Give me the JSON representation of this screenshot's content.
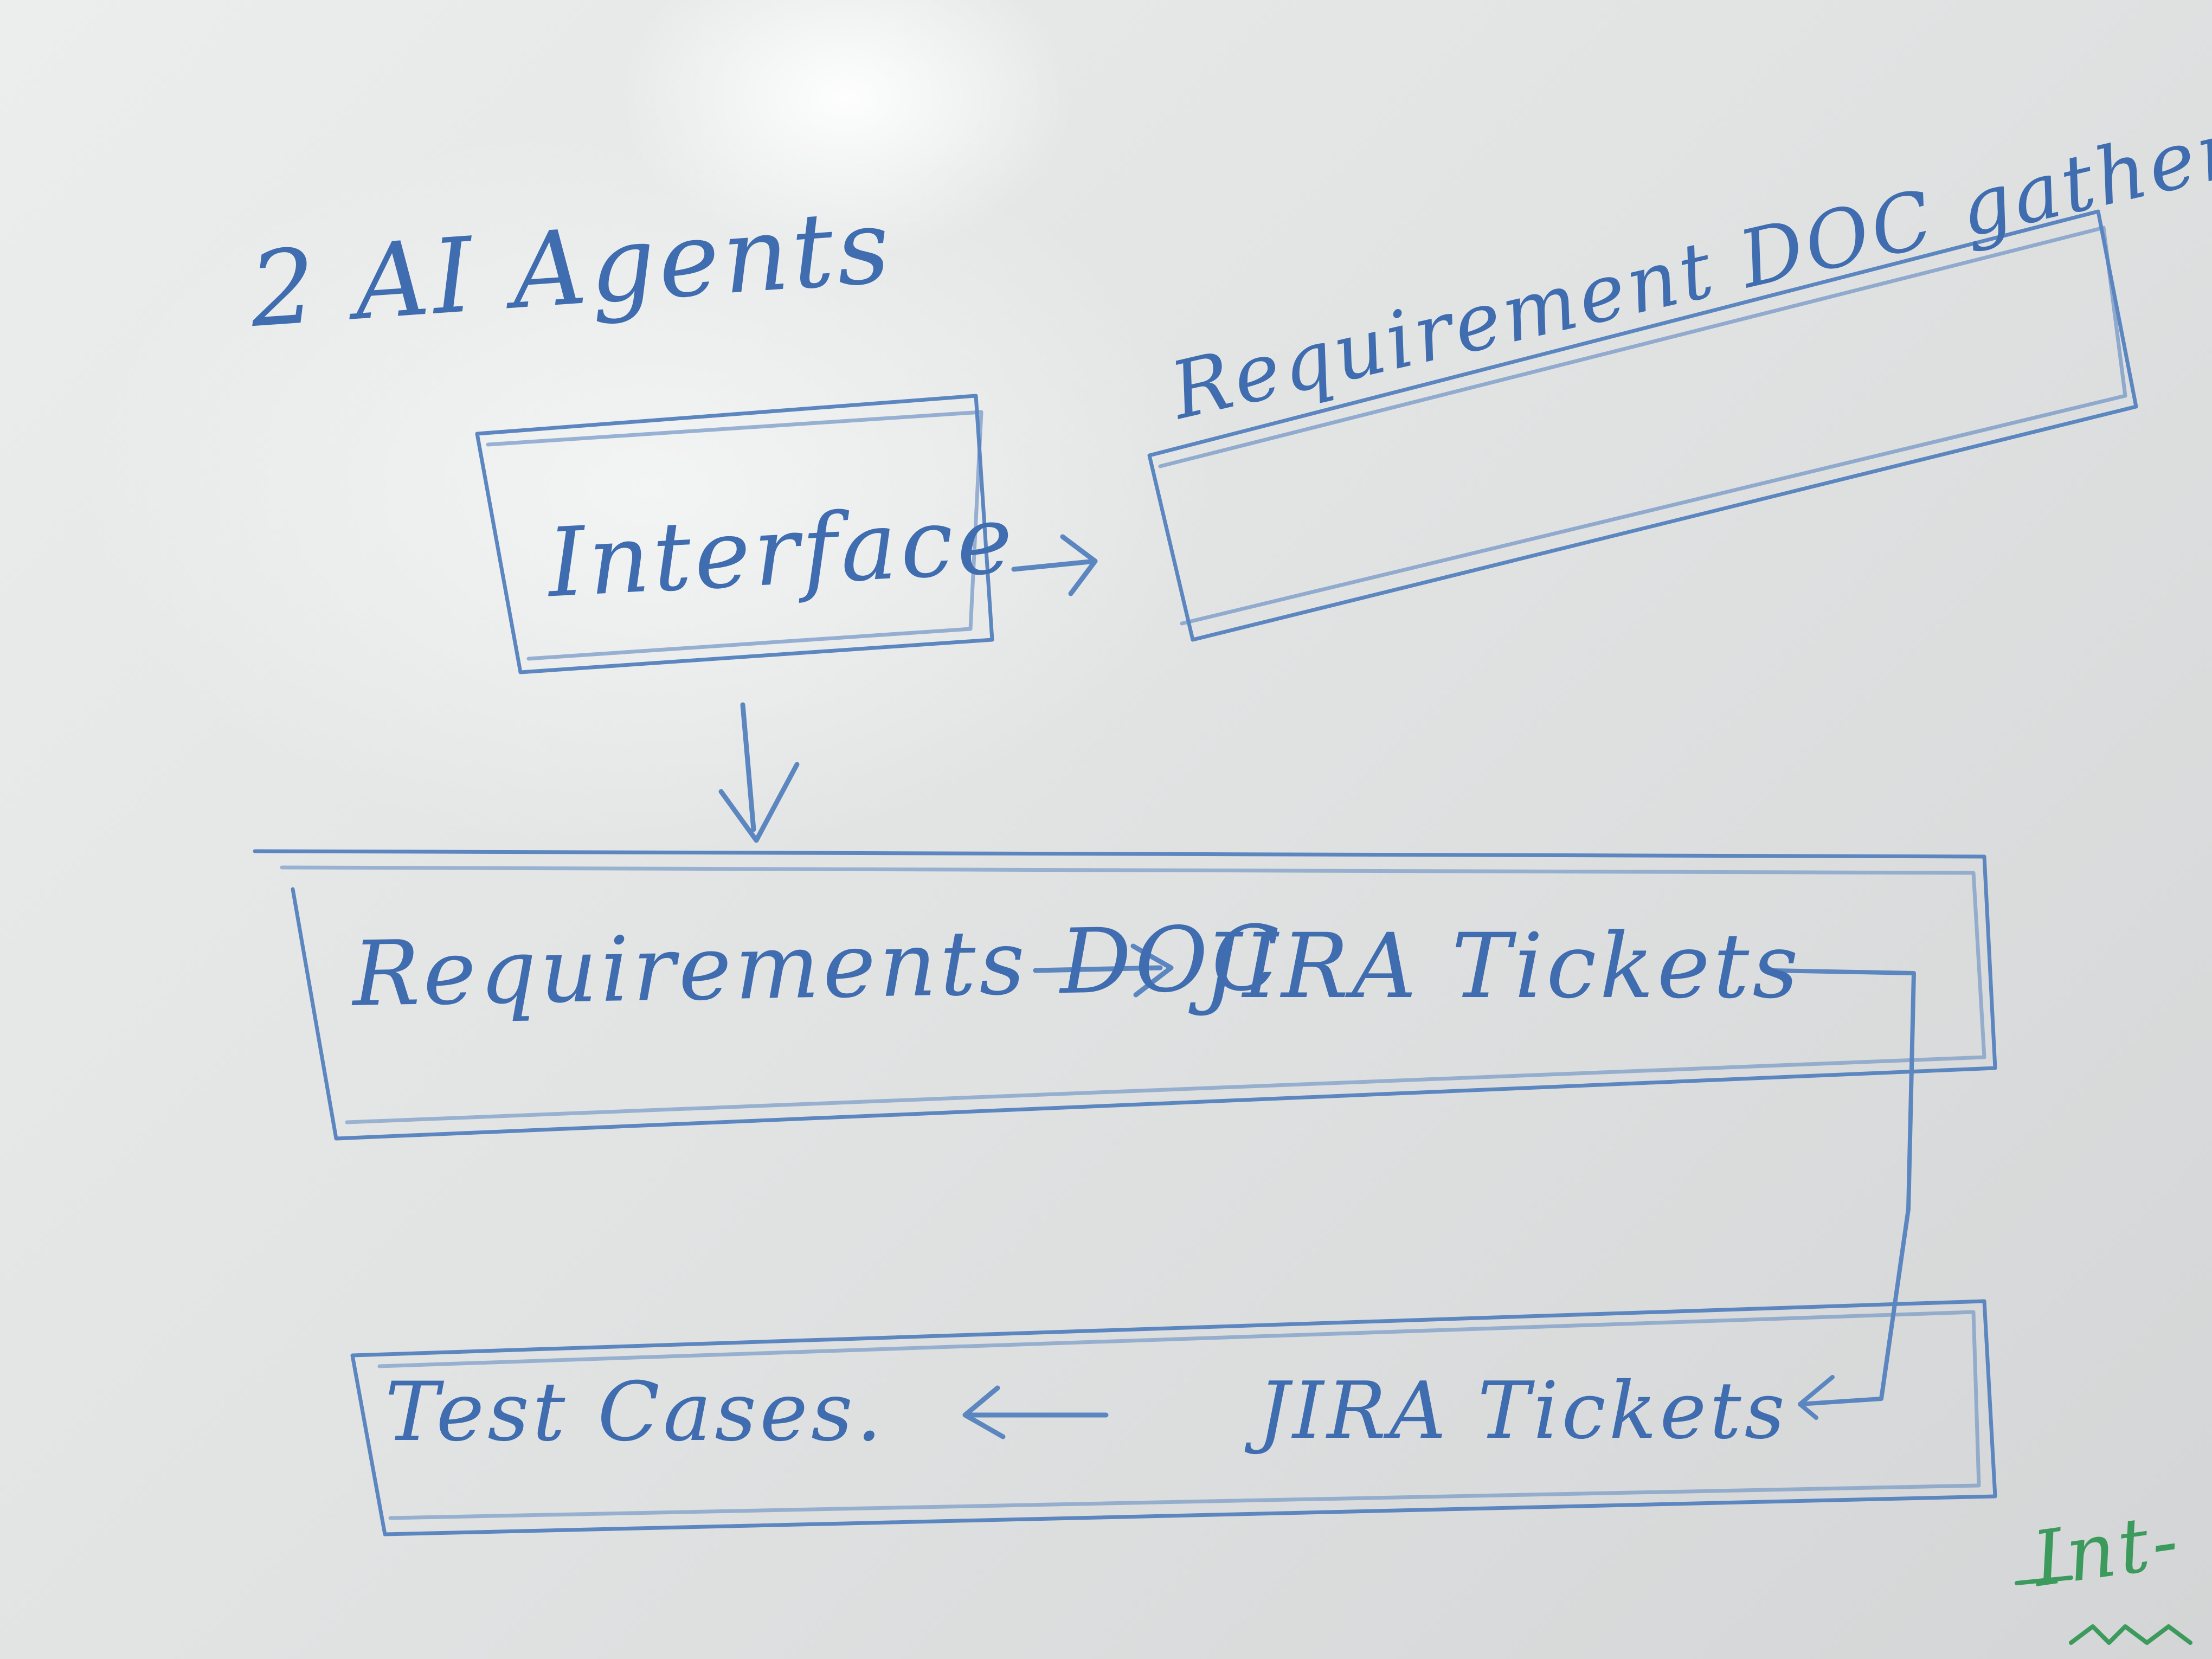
{
  "title": "2 AI Agents",
  "boxes": {
    "interface": "Interface",
    "requirement_gathering": "Requirement DOC gathering",
    "requirements_doc": "Requirements DOC",
    "jira_tickets_top": "JIRA Tickets",
    "test_cases": "Test Cases.",
    "jira_tickets_bottom": "JIRA Tickets"
  },
  "margin_note": "Int-",
  "colors": {
    "marker_blue": "#3f6db0",
    "marker_green": "#3b9a5c"
  }
}
